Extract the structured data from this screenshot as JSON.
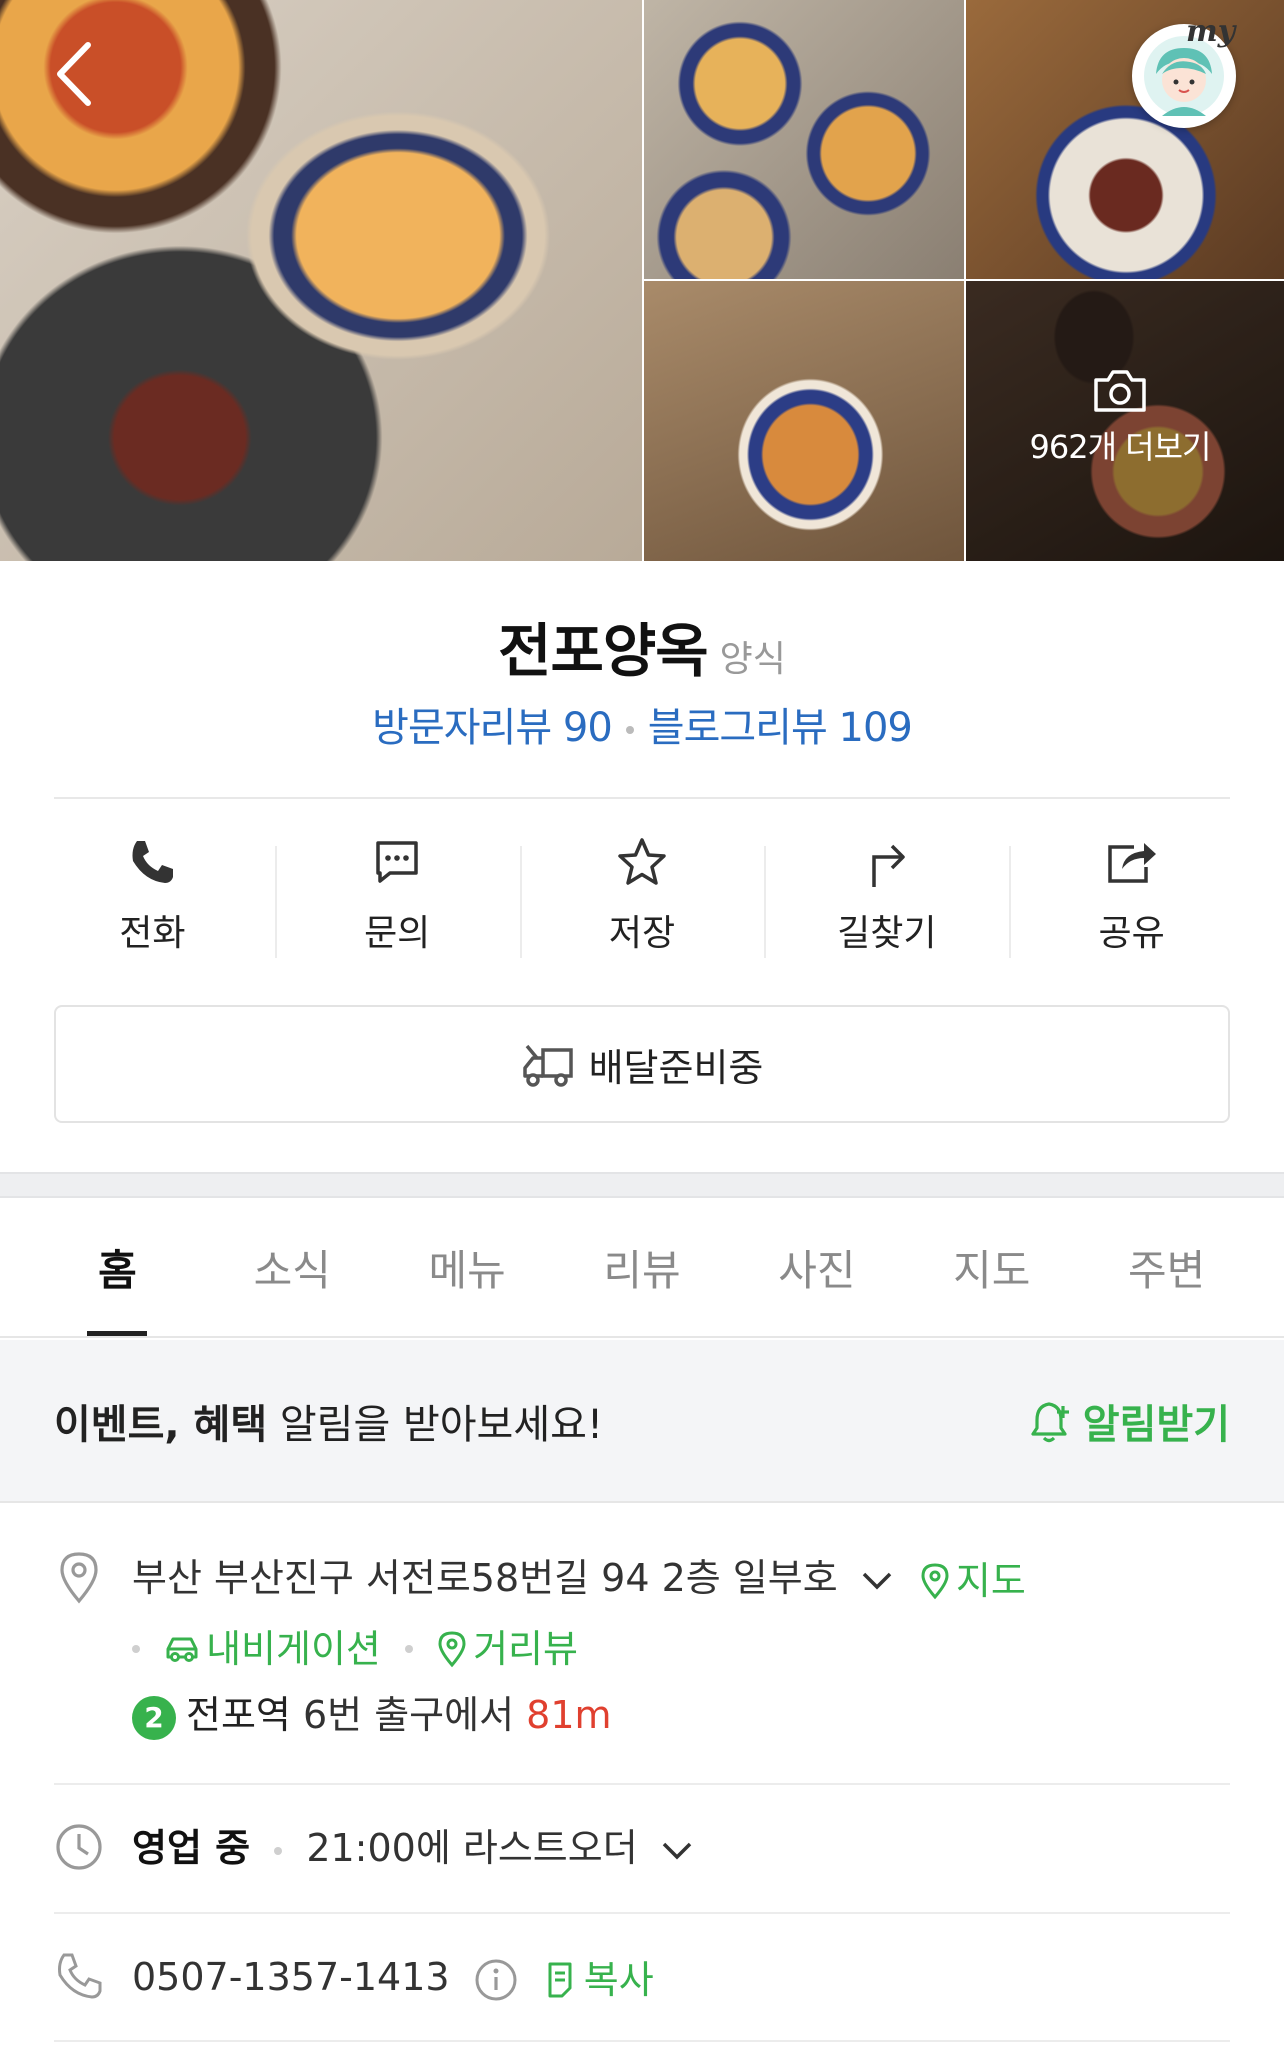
{
  "gallery": {
    "more_photos_label": "962개 더보기",
    "my_label": "my"
  },
  "place": {
    "name": "전포양옥",
    "category": "양식",
    "visitor_review": "방문자리뷰 90",
    "blog_review": "블로그리뷰 109"
  },
  "actions": [
    {
      "label": "전화",
      "icon": "phone-icon"
    },
    {
      "label": "문의",
      "icon": "chat-icon"
    },
    {
      "label": "저장",
      "icon": "star-icon"
    },
    {
      "label": "길찾기",
      "icon": "directions-icon"
    },
    {
      "label": "공유",
      "icon": "share-icon"
    }
  ],
  "delivery": {
    "label": "배달준비중"
  },
  "tabs": [
    "홈",
    "소식",
    "메뉴",
    "리뷰",
    "사진",
    "지도",
    "주변"
  ],
  "active_tab": "홈",
  "notice": {
    "bold_part": "이벤트, 혜택",
    "rest": " 알림을 받아보세요!",
    "button": "알림받기"
  },
  "address": {
    "text": "부산 부산진구 서전로58번길 94 2층 일부호",
    "map_link": "지도",
    "navigation_link": "내비게이션",
    "streetview_link": "거리뷰",
    "subway_line": "2",
    "station": "전포역",
    "exit_text": "6번 출구에서",
    "distance": "81m"
  },
  "hours": {
    "status": "영업 중",
    "detail": "21:00에 라스트오더"
  },
  "phone": {
    "number": "0507-1357-1413",
    "copy_label": "복사"
  },
  "colors": {
    "accent_green": "#37b24d",
    "review_blue": "#2a6cc0",
    "distance_red": "#e0402f"
  }
}
